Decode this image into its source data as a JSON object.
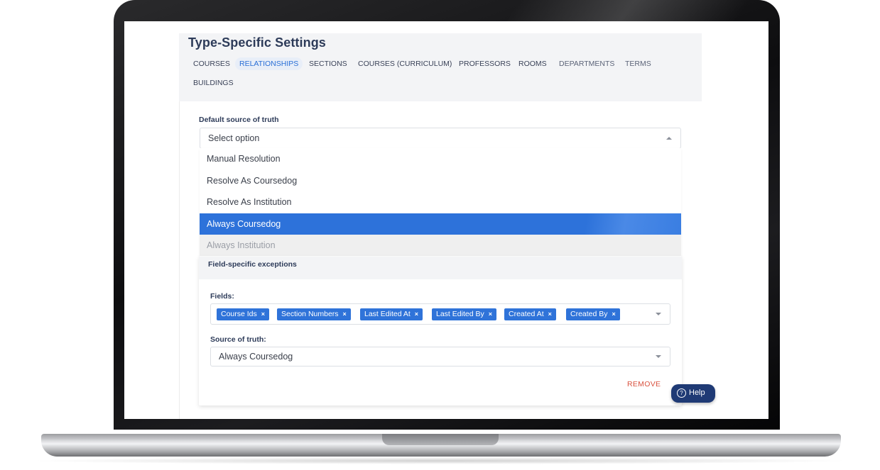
{
  "page_title": "Type-Specific Settings",
  "tabs": [
    {
      "label": "COURSES",
      "state": "normal"
    },
    {
      "label": "RELATIONSHIPS",
      "state": "active"
    },
    {
      "label": "SECTIONS",
      "state": "normal"
    },
    {
      "label": "COURSES (CURRICULUM)",
      "state": "normal"
    },
    {
      "label": "PROFESSORS",
      "state": "normal"
    },
    {
      "label": "ROOMS",
      "state": "normal"
    },
    {
      "label": "DEPARTMENTS",
      "state": "dim"
    },
    {
      "label": "TERMS",
      "state": "dim"
    },
    {
      "label": "BUILDINGS",
      "state": "normal"
    }
  ],
  "default_source": {
    "label": "Default source of truth",
    "placeholder": "Select option",
    "options": [
      {
        "label": "Manual Resolution",
        "state": "normal"
      },
      {
        "label": "Resolve As Coursedog",
        "state": "normal"
      },
      {
        "label": "Resolve As Institution",
        "state": "normal"
      },
      {
        "label": "Always Coursedog",
        "state": "highlighted"
      },
      {
        "label": "Always Institution",
        "state": "disabled"
      }
    ]
  },
  "exceptions": {
    "title": "Field-specific exceptions",
    "fields_label": "Fields:",
    "chips": [
      "Course Ids",
      "Section Numbers",
      "Last Edited At",
      "Last Edited By",
      "Created At",
      "Created By"
    ],
    "chip_remove_symbol": "×",
    "source_label": "Source of truth:",
    "source_value": "Always Coursedog",
    "remove_label": "REMOVE"
  },
  "help": {
    "icon_glyph": "?",
    "label": "Help"
  },
  "colors": {
    "accent": "#2f73d9",
    "title": "#2d3b59",
    "remove": "#d9523f",
    "help_bg": "#1f3a75"
  }
}
